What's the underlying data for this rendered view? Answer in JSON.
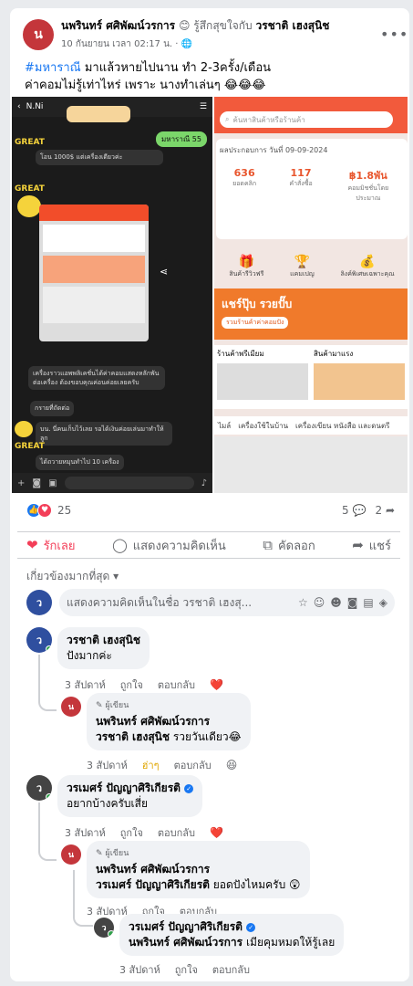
{
  "post": {
    "author": "นพรินทร์ ศศิพัฒน์วรการ",
    "feeling": "😊 รู้สึกสุขใจกับ",
    "tagged": "วรชาติ เฮงสุนิช",
    "time": "10 กันยายน เวลา 02:17 น. ·",
    "privacy_icon": "globe-icon",
    "more_label": "•••",
    "hashtag": "#มหาราณี",
    "text_line1_rest": " มาแล้วหายไปนาน ทำ 2-3ครั้ง/เดือน",
    "text_line2": "ค่าคอมไม่รู้เท่าไหร่ เพราะ นางทำเล่นๆ 😂😂😂"
  },
  "media": {
    "left": {
      "chat_title": "N.Ni",
      "bubble_1": "มหาราณี 55",
      "msg_1": "โอน 1000$ แต่เครื่องเดียวค่ะ",
      "msg_2": "เครื่องราวแอพพลิเคชั่นได้ค่าคอมแสดงหลักพัน ต่อเครื่อง ต้องขอบคุณค่อนค่อยเลยครับ",
      "msg_3": "กรายที่ถัดต่อ",
      "msg_4": "บน. นี่คนเก็บไว้เลย รอได้เงินค่อยเล่นมาทำให้ลูก",
      "msg_5": "ได้ถวายหมุนทำไป 10 เครื่อง",
      "great": "GREAT"
    },
    "right": {
      "search_placeholder": "ค้นหาสินค้าหรือร้านค้า",
      "date_label": "ผลประกอบการ วันที่ 09-09-2024",
      "stat_1_value": "636",
      "stat_1_label": "ยอดคลิก",
      "stat_2_value": "117",
      "stat_2_label": "คำสั่งซื้อ",
      "stat_3_value": "฿1.8พัน",
      "stat_3_label": "คอมมิชชั่นโดยประมาณ",
      "menu_1": "สินค้ารีวิวฟรี",
      "menu_2": "แคมเปญ",
      "menu_3": "ลิงค์พิเศษเฉพาะคุณ",
      "banner_title": "แชร์ปุ๊บ รวยปั๊บ",
      "banner_sub": "รวมร้านค้าค่าคอมปัง",
      "section_1": "ร้านค้าพรีเมียม",
      "section_2": "สินค้ามาแรง",
      "tab_1": "ไมล์",
      "tab_2": "เครื่องใช้ในบ้าน",
      "tab_3": "เครื่องเขียน หนังสือ และดนตรี"
    }
  },
  "stats": {
    "reaction_count": "25",
    "comment_count": "5",
    "share_count": "2"
  },
  "actions": {
    "love": "รักเลย",
    "comment": "แสดงความคิดเห็น",
    "copy": "คัดลอก",
    "share": "แชร์"
  },
  "sort_label": "เกี่ยวข้องมากที่สุด ▾",
  "composer": {
    "placeholder": "แสดงความคิดเห็นในชื่อ วรชาติ เฮงสุ..."
  },
  "comments": [
    {
      "name": "วรชาติ เฮงสุนิช",
      "text": "ปังมากค่ะ",
      "age": "3 สัปดาห์",
      "like": "ถูกใจ",
      "reply": "ตอบกลับ",
      "reaction": "❤️"
    },
    {
      "author_tag": "ผู้เขียน",
      "name": "นพรินทร์ ศศิพัฒน์วรการ",
      "mention": "วรชาติ เฮงสุนิช",
      "text": " รวยวันเดียว😂",
      "age": "3 สัปดาห์",
      "like": "ฮ่าๆ",
      "reply": "ตอบกลับ",
      "reaction": "😆"
    },
    {
      "name": "วรเมศร์ ปัญญาศิริเกียรติ",
      "text": "อยากบ้างครับเสี่ย",
      "age": "3 สัปดาห์",
      "like": "ถูกใจ",
      "reply": "ตอบกลับ",
      "reaction": "❤️"
    },
    {
      "author_tag": "ผู้เขียน",
      "name": "นพรินทร์ ศศิพัฒน์วรการ",
      "mention": "วรเมศร์ ปัญญาศิริเกียรติ",
      "text": " ยอดปังไหมครับ 😲",
      "age": "3 สัปดาห์",
      "like": "ถูกใจ",
      "reply": "ตอบกลับ"
    },
    {
      "name": "วรเมศร์ ปัญญาศิริเกียรติ",
      "mention": "นพรินทร์ ศศิพัฒน์วรการ",
      "text": " เมียคุมหมดให้รู้เลย",
      "age": "3 สัปดาห์",
      "like": "ถูกใจ",
      "reply": "ตอบกลับ"
    }
  ]
}
